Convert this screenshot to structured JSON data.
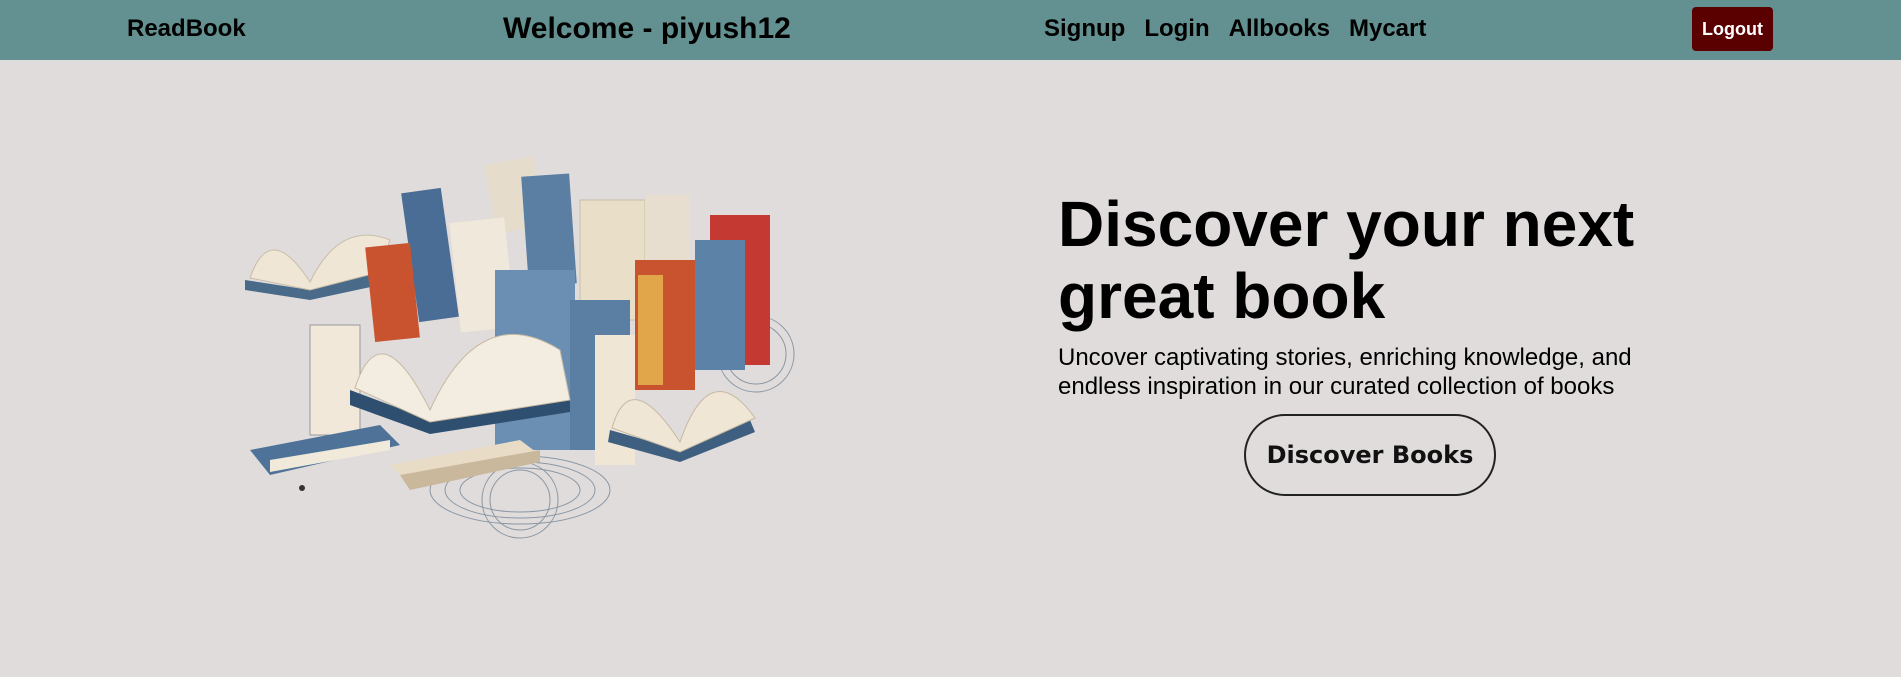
{
  "navbar": {
    "brand": "ReadBook",
    "welcome": "Welcome - piyush12",
    "links": [
      "Signup",
      "Login",
      "Allbooks",
      "Mycart"
    ],
    "logout_label": "Logout"
  },
  "hero": {
    "image_icon": "books-illustration",
    "title": "Discover your next great book",
    "subtitle": "Uncover captivating stories, enriching knowledge, and endless inspiration in our curated collection of books",
    "cta_label": "Discover Books"
  },
  "colors": {
    "navbar_bg": "#639090",
    "page_bg": "#e0dcdc",
    "logout_bg": "#5a0000"
  }
}
